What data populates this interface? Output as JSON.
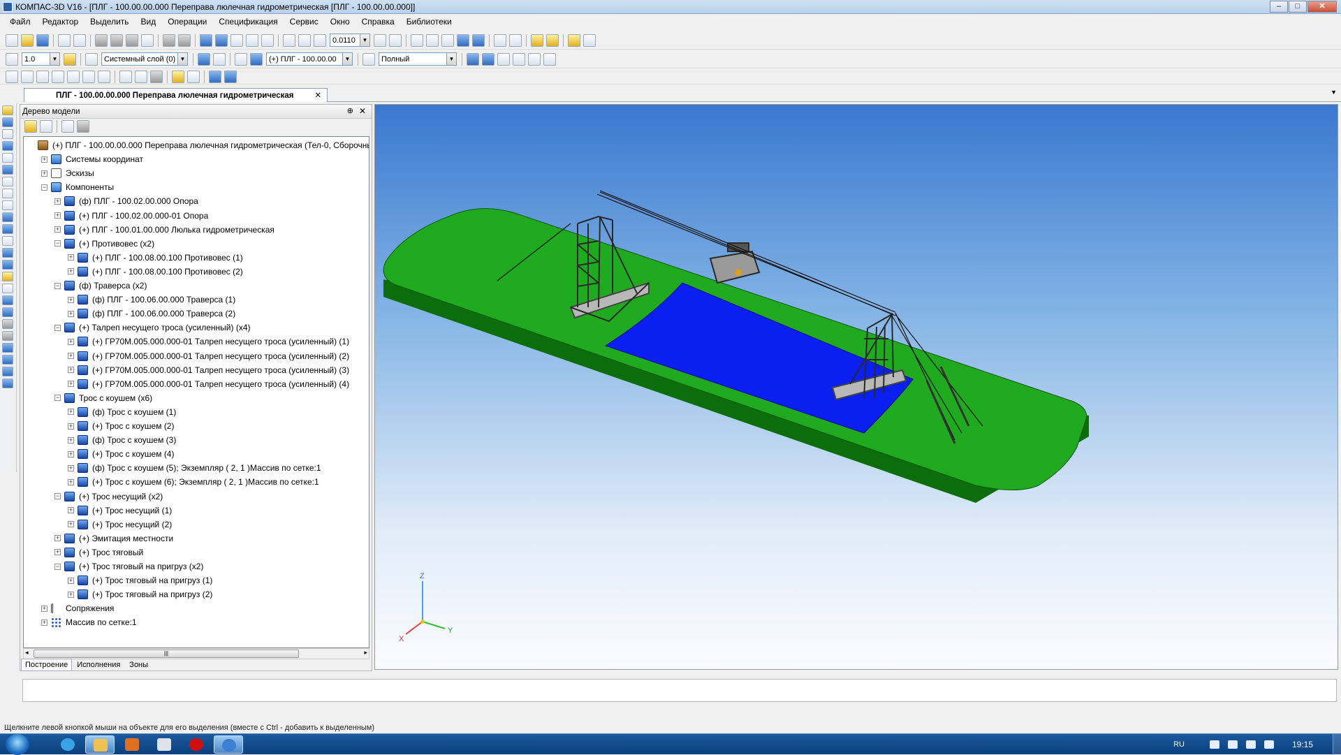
{
  "window": {
    "title": "КОМПАС-3D V16 - [ПЛГ - 100.00.00.000 Переправа люлечная гидрометрическая [ПЛГ - 100.00.00.000]]",
    "buttons": {
      "min": "–",
      "max": "□",
      "close": "✕"
    }
  },
  "menu": [
    "Файл",
    "Редактор",
    "Выделить",
    "Вид",
    "Операции",
    "Спецификация",
    "Сервис",
    "Окно",
    "Справка",
    "Библиотеки"
  ],
  "toolbar": {
    "zoom_value": "0.0110",
    "step_value": "1.0",
    "layer_value": "Системный слой (0)",
    "state_value": "(+) ПЛГ - 100.00.00",
    "display_mode": "Полный"
  },
  "doc_tab": {
    "label": "ПЛГ - 100.00.00.000 Переправа люлечная гидрометрическая",
    "close": "✕"
  },
  "panel": {
    "title": "Дерево модели",
    "pin": "⊕",
    "close": "✕",
    "bottom_tabs": [
      "Построение",
      "Исполнения",
      "Зоны"
    ]
  },
  "tree": [
    {
      "level": 0,
      "exp": "",
      "icon": "asm",
      "label": "(+) ПЛГ - 100.00.00.000 Переправа люлечная гидрометрическая (Тел-0, Сборочны"
    },
    {
      "level": 1,
      "exp": "+",
      "icon": "cs",
      "label": "Системы координат"
    },
    {
      "level": 1,
      "exp": "+",
      "icon": "sk",
      "label": "Эскизы"
    },
    {
      "level": 1,
      "exp": "−",
      "icon": "cs",
      "label": "Компоненты"
    },
    {
      "level": 2,
      "exp": "+",
      "icon": "part",
      "label": "(ф) ПЛГ - 100.02.00.000 Опора"
    },
    {
      "level": 2,
      "exp": "+",
      "icon": "part",
      "label": "(+) ПЛГ - 100.02.00.000-01 Опора"
    },
    {
      "level": 2,
      "exp": "+",
      "icon": "part",
      "label": "(+) ПЛГ - 100.01.00.000 Люлька гидрометрическая"
    },
    {
      "level": 2,
      "exp": "−",
      "icon": "part",
      "label": "(+) Противовес (x2)"
    },
    {
      "level": 3,
      "exp": "+",
      "icon": "part",
      "label": "(+) ПЛГ - 100.08.00.100 Противовес (1)"
    },
    {
      "level": 3,
      "exp": "+",
      "icon": "part",
      "label": "(+) ПЛГ - 100.08.00.100 Противовес (2)"
    },
    {
      "level": 2,
      "exp": "−",
      "icon": "part",
      "label": "(ф) Траверса (x2)"
    },
    {
      "level": 3,
      "exp": "+",
      "icon": "part",
      "label": "(ф) ПЛГ - 100.06.00.000 Траверса (1)"
    },
    {
      "level": 3,
      "exp": "+",
      "icon": "part",
      "label": "(ф) ПЛГ - 100.06.00.000 Траверса (2)"
    },
    {
      "level": 2,
      "exp": "−",
      "icon": "part",
      "label": "(+) Талреп несущего троса (усиленный) (x4)"
    },
    {
      "level": 3,
      "exp": "+",
      "icon": "part",
      "label": "(+) ГР70М.005.000.000-01 Талреп несущего троса (усиленный) (1)"
    },
    {
      "level": 3,
      "exp": "+",
      "icon": "part",
      "label": "(+) ГР70М.005.000.000-01 Талреп несущего троса (усиленный) (2)"
    },
    {
      "level": 3,
      "exp": "+",
      "icon": "part",
      "label": "(+) ГР70М.005.000.000-01 Талреп несущего троса (усиленный) (3)"
    },
    {
      "level": 3,
      "exp": "+",
      "icon": "part",
      "label": "(+) ГР70М.005.000.000-01 Талреп несущего троса (усиленный) (4)"
    },
    {
      "level": 2,
      "exp": "−",
      "icon": "part",
      "label": "Трос с коушем (x6)"
    },
    {
      "level": 3,
      "exp": "+",
      "icon": "part",
      "label": "(ф) Трос с коушем (1)"
    },
    {
      "level": 3,
      "exp": "+",
      "icon": "part",
      "label": "(+) Трос с коушем (2)"
    },
    {
      "level": 3,
      "exp": "+",
      "icon": "part",
      "label": "(ф) Трос с коушем (3)"
    },
    {
      "level": 3,
      "exp": "+",
      "icon": "part",
      "label": "(+) Трос с коушем (4)"
    },
    {
      "level": 3,
      "exp": "+",
      "icon": "part",
      "label": "(ф) Трос с коушем (5); Экземпляр ( 2, 1 )Массив по сетке:1"
    },
    {
      "level": 3,
      "exp": "+",
      "icon": "part",
      "label": "(+) Трос с коушем (6); Экземпляр ( 2, 1 )Массив по сетке:1"
    },
    {
      "level": 2,
      "exp": "−",
      "icon": "part",
      "label": "(+) Трос несущий (x2)"
    },
    {
      "level": 3,
      "exp": "+",
      "icon": "part",
      "label": "(+) Трос несущий (1)"
    },
    {
      "level": 3,
      "exp": "+",
      "icon": "part",
      "label": "(+) Трос несущий (2)"
    },
    {
      "level": 2,
      "exp": "+",
      "icon": "part",
      "label": "(+) Эмитация местности"
    },
    {
      "level": 2,
      "exp": "+",
      "icon": "part",
      "label": "(+) Трос тяговый"
    },
    {
      "level": 2,
      "exp": "−",
      "icon": "part",
      "label": "(+) Трос тяговый на пригруз (x2)"
    },
    {
      "level": 3,
      "exp": "+",
      "icon": "part",
      "label": "(+) Трос тяговый на пригруз (1)"
    },
    {
      "level": 3,
      "exp": "+",
      "icon": "part",
      "label": "(+) Трос тяговый на пригруз (2)"
    },
    {
      "level": 1,
      "exp": "+",
      "icon": "mate",
      "label": "Сопряжения"
    },
    {
      "level": 1,
      "exp": "+",
      "icon": "grid",
      "label": "Массив по сетке:1"
    }
  ],
  "scene": {
    "ground_color": "#1faa1f",
    "river_color": "#0b1ff0",
    "frame_color": "#8a8a8a",
    "axis_labels": {
      "x": "X",
      "y": "Y",
      "z": "Z"
    }
  },
  "status": "Щелкните левой кнопкой мыши на объекте для его выделения (вместе с Ctrl - добавить к выделенным)",
  "taskbar": {
    "lang": "RU",
    "clock": "19:15"
  }
}
